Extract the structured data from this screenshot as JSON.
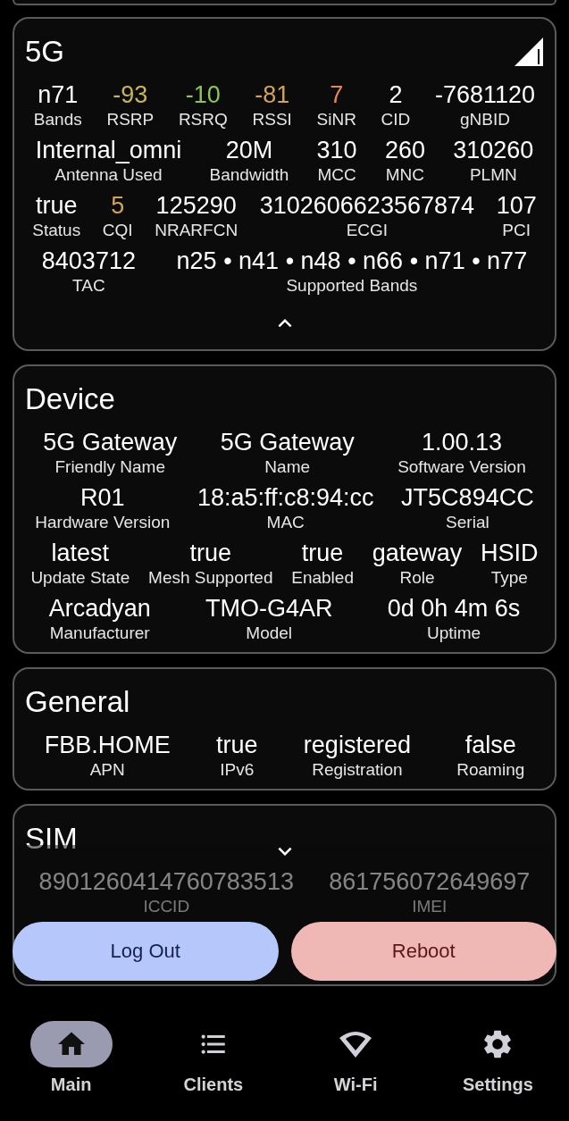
{
  "cards": [
    {
      "title": "5G",
      "expanded": true,
      "rows": [
        {
          "items": [
            {
              "value": "n71",
              "label": "Bands"
            },
            {
              "value": "-93",
              "label": "RSRP",
              "color": "#c8b45a"
            },
            {
              "value": "-10",
              "label": "RSRQ",
              "color": "#8dc653"
            },
            {
              "value": "-81",
              "label": "RSSI",
              "color": "#d2a259"
            },
            {
              "value": "7",
              "label": "SiNR",
              "color": "#e08a5c"
            },
            {
              "value": "2",
              "label": "CID"
            },
            {
              "value": "-7681120",
              "label": "gNBID"
            }
          ]
        },
        {
          "items": [
            {
              "value": "Internal_omni",
              "label": "Antenna Used"
            },
            {
              "value": "20M",
              "label": "Bandwidth"
            },
            {
              "value": "310",
              "label": "MCC"
            },
            {
              "value": "260",
              "label": "MNC"
            },
            {
              "value": "310260",
              "label": "PLMN"
            }
          ]
        },
        {
          "items": [
            {
              "value": "true",
              "label": "Status"
            },
            {
              "value": "5",
              "label": "CQI",
              "color": "#d2a259"
            },
            {
              "value": "125290",
              "label": "NRARFCN"
            },
            {
              "value": "3102606623567874",
              "label": "ECGI"
            },
            {
              "value": "107",
              "label": "PCI"
            }
          ]
        },
        {
          "items": [
            {
              "value": "8403712",
              "label": "TAC"
            },
            {
              "value": "n25 • n41 • n48 • n66 • n71 • n77",
              "label": "Supported Bands"
            }
          ]
        }
      ]
    },
    {
      "title": "Device",
      "rows": [
        {
          "items": [
            {
              "value": "5G Gateway",
              "label": "Friendly Name"
            },
            {
              "value": "5G Gateway",
              "label": "Name"
            },
            {
              "value": "1.00.13",
              "label": "Software Version"
            }
          ]
        },
        {
          "items": [
            {
              "value": "R01",
              "label": "Hardware Version"
            },
            {
              "value": "18:a5:ff:c8:94:cc",
              "label": "MAC"
            },
            {
              "value": "JT5C894CC",
              "label": "Serial"
            }
          ]
        },
        {
          "items": [
            {
              "value": "latest",
              "label": "Update State"
            },
            {
              "value": "true",
              "label": "Mesh Supported"
            },
            {
              "value": "true",
              "label": "Enabled"
            },
            {
              "value": "gateway",
              "label": "Role"
            },
            {
              "value": "HSID",
              "label": "Type"
            }
          ]
        },
        {
          "items": [
            {
              "value": "Arcadyan",
              "label": "Manufacturer"
            },
            {
              "value": "TMO-G4AR",
              "label": "Model"
            },
            {
              "value": "0d 0h 4m 6s",
              "label": "Uptime"
            }
          ]
        }
      ]
    },
    {
      "title": "General",
      "rows": [
        {
          "items": [
            {
              "value": "FBB.HOME",
              "label": "APN"
            },
            {
              "value": "true",
              "label": "IPv6"
            },
            {
              "value": "registered",
              "label": "Registration"
            },
            {
              "value": "false",
              "label": "Roaming"
            }
          ]
        }
      ]
    },
    {
      "title": "SIM",
      "expanded": false,
      "rows": [
        {
          "items": [
            {
              "value": "8901260414760783513",
              "label": "ICCID"
            },
            {
              "value": "861756072649697",
              "label": "IMEI"
            }
          ]
        }
      ]
    }
  ],
  "actions": [
    {
      "label": "Log Out",
      "kind": "logout"
    },
    {
      "label": "Reboot",
      "kind": "reboot"
    }
  ],
  "nav": [
    {
      "label": "Main",
      "selected": true
    },
    {
      "label": "Clients",
      "selected": false
    },
    {
      "label": "Wi-Fi",
      "selected": false
    },
    {
      "label": "Settings",
      "selected": false
    }
  ]
}
